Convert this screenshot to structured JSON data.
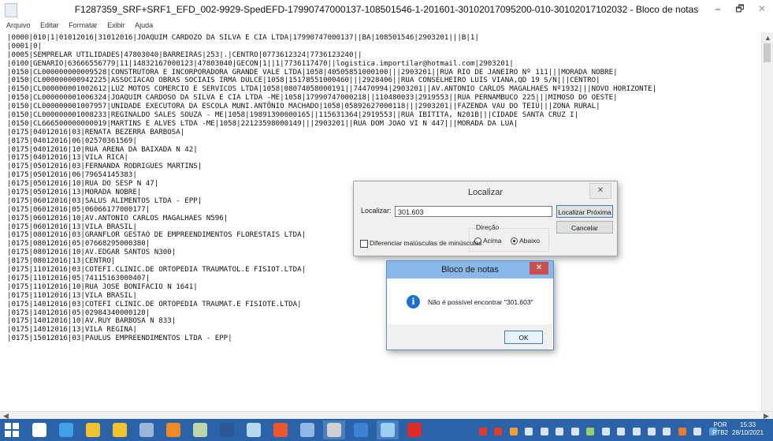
{
  "window": {
    "title": "F1287359_SRF+SRF1_EFD_002-9929-SpedEFD-17990747000137-108501546-1-201601-30102017095200-010-30102017102032 - Bloco de notas",
    "minimize": "–",
    "maximize": "🗗",
    "close": "✕"
  },
  "menu": [
    "Arquivo",
    "Editar",
    "Formatar",
    "Exibir",
    "Ajuda"
  ],
  "editor_lines": [
    "|0000|010|1|01012016|31012016|JOAQUIM CARDOZO DA SILVA E CIA LTDA|17990747000137||BA|108501546|2903201|||B|1|",
    "|0001|0|",
    "|0005|SEMPRELAR UTILIDADES|47803040|BARREIRAS|253|.|CENTRO|0773612324|7736123240||",
    "|0100|GENARIO|63666556779|11|14832167000123|47803040|GECON|1||1|7736117470||logistica.importilar@hotmail.com|2903201|",
    "|0150|CL000000000009528|CONSTRUTORA E INCORPORADORA GRANDE VALE LTDA|1058|40505851000100|||2903201||RUA RIO DE JANEIRO Nº 111|||MORADA NOBRE|",
    "|0150|CL000000000942225|ASSOCIACAO OBRAS SOCIAIS IRMA DULCE|1058|15178551000460|||2928406||RUA CONSELHEIRO LUIS VIANA,QD 19 S/N|||CENTRO|",
    "|0150|CL000000001002612|LUZ MOTOS COMERCIO E SERVICOS LTDA|1058|08074058000191||74470994|2903201||AV.ANTONIO CARLOS MAGALHAES Nº1932|||NOVO HORIZONTE|",
    "|0150|CL000000001006324|JOAQUIM CARDOSO DA SILVA E CIA LTDA -ME|1058|17990747000218||110480033|2919553||RUA PERNAMBUCO 225|||MIMOSO DO OESTE|",
    "|0150|CL000000001007957|UNIDADE EXECUTORA DA ESCOLA MUNI.ANTÔNIO MACHADO|1058|05892627000118|||2903201||FAZENDA VAU DO TEIÚ|||ZONA RURAL|",
    "|0150|CL000000001008233|REGINALDO SALES SOUZA - ME|1058|19891390000165||115631364|2919553||RUA IBITITA, N201B|||CIDADE SANTA CRUZ I|",
    "|0150|CL666500000000019|MARTINS E ALVES LTDA -ME|1058|22123598000149|||2903201||RUA DOM JOAO VI N 447|||MORADA DA LUA|",
    "|0175|04012016|03|RENATA BEZERRA BARBOSA|",
    "|0175|04012016|06|02570361569|",
    "|0175|04012016|10|RUA ARENA DA BAIXADA N 42|",
    "|0175|04012016|13|VILA RICA|",
    "|0175|05012016|03|FERNANDA RODRIGUES MARTINS|",
    "|0175|05012016|06|79654145383|",
    "|0175|05012016|10|RUA DO SESP N 47|",
    "|0175|05012016|13|MORADA NOBRE|",
    "|0175|06012016|03|SALUS ALIMENTOS LTDA - EPP|",
    "|0175|06012016|05|06066177000177|",
    "|0175|06012016|10|AV.ANTONIO CARLOS MAGALHAES N596|",
    "|0175|06012016|13|VILA BRASIL|",
    "|0175|08012016|03|GRANFLOR GESTAO DE EMPREENDIMENTOS FLORESTAIS LTDA|",
    "|0175|08012016|05|07668295000380|",
    "|0175|08012016|10|AV.EDGAR SANTOS N300|",
    "|0175|08012016|13|CENTRO|",
    "|0175|11012016|03|COTEFI.CLINIC.DE ORTOPEDIA TRAUMATOL.E FISIOT.LTDA|",
    "|0175|11012016|05|74115163000407|",
    "|0175|11012016|10|RUA JOSE BONIFACIO N 1641|",
    "|0175|11012016|13|VILA BRASIL|",
    "|0175|14012016|03|COTEFI CLINIC.DE ORTOPEDIA TRAUMAT.E FISIOTE.LTDA|",
    "|0175|14012016|05|02984340000120|",
    "|0175|14012016|10|AV.RUY BARBOSA N 833|",
    "|0175|14012016|13|VILA REGINA|",
    "|0175|15012016|03|PAULUS EMPREENDIMENTOS LTDA - EPP|"
  ],
  "find_dialog": {
    "title": "Localizar",
    "close": "✕",
    "find_label": "Localizar:",
    "find_value": "301.603",
    "find_next": "Localizar Próxima",
    "cancel": "Cancelar",
    "direction_label": "Direção",
    "up": "Acima",
    "down": "Abaixo",
    "direction_selected": "down",
    "match_case": "Diferenciar maiúsculas de minúsculas",
    "match_case_checked": false
  },
  "message_box": {
    "title": "Bloco de notas",
    "close": "✕",
    "icon": "info-icon",
    "text": "Não é possível encontrar \"301.603\"",
    "ok": "OK"
  },
  "taskbar": {
    "language": [
      "POR",
      "PTB2"
    ],
    "time": "15:33",
    "date": "28/10/2021",
    "apps": [
      "edge-icon",
      "edge-chromium-icon",
      "chrome-icon",
      "file-explorer-icon",
      "app-icon",
      "paint-icon",
      "calculator-icon",
      "word-icon",
      "app-icon",
      "firefox-icon",
      "app-icon",
      "app-icon",
      "cortana-icon",
      "app-icon",
      "acrobat-icon"
    ],
    "accent": "#2b63a8"
  }
}
